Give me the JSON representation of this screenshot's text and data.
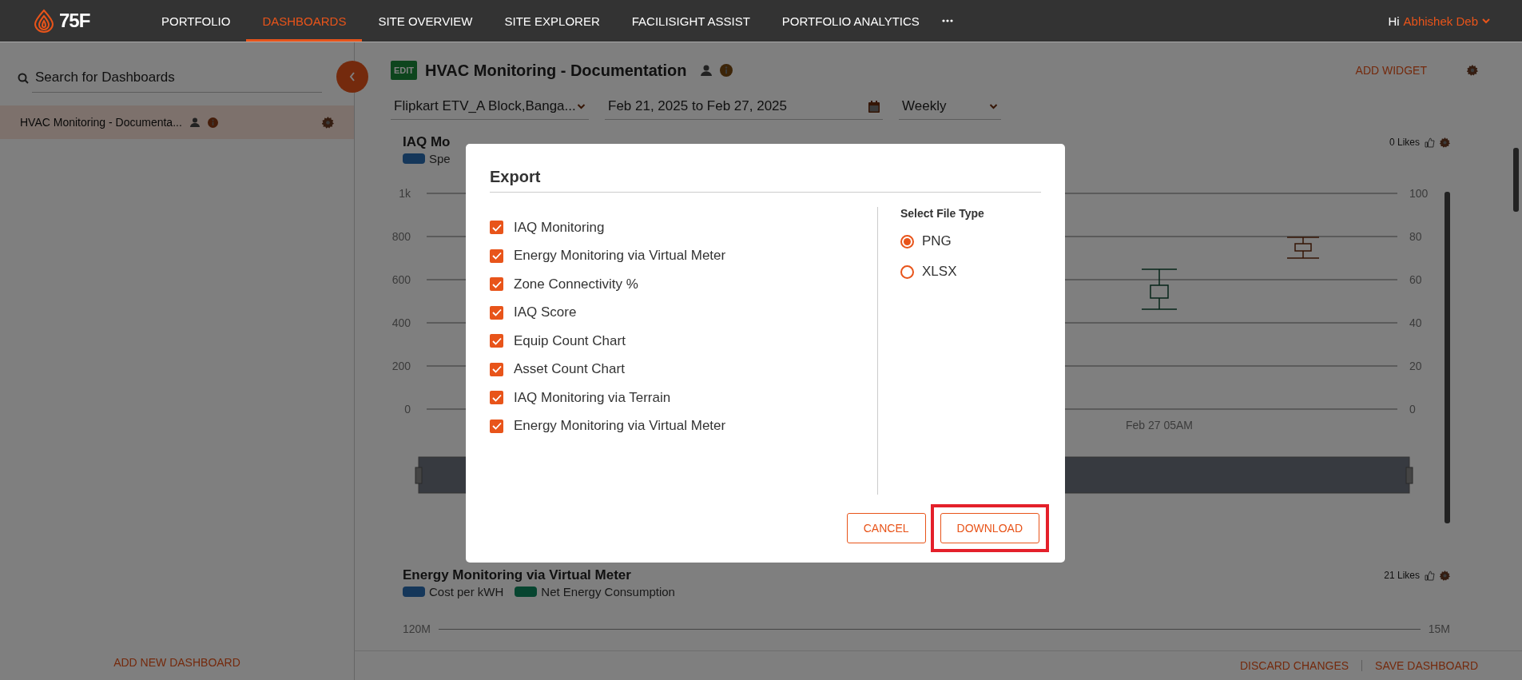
{
  "header": {
    "logo_text": "75F",
    "nav": [
      {
        "label": "PORTFOLIO",
        "selected": false
      },
      {
        "label": "DASHBOARDS",
        "selected": true
      },
      {
        "label": "SITE OVERVIEW",
        "selected": false
      },
      {
        "label": "SITE EXPLORER",
        "selected": false
      },
      {
        "label": "FACILISIGHT ASSIST",
        "selected": false
      },
      {
        "label": "PORTFOLIO ANALYTICS",
        "selected": false
      }
    ],
    "greeting": "Hi",
    "user": "Abhishek Deb"
  },
  "sidebar": {
    "search_placeholder": "Search for Dashboards",
    "items": [
      {
        "label": "HVAC Monitoring - Documenta...",
        "selected": true
      }
    ],
    "add_button": "ADD NEW DASHBOARD"
  },
  "dashboard": {
    "edit_badge": "EDIT",
    "title": "HVAC Monitoring - Documentation",
    "add_widget": "ADD WIDGET",
    "filters": {
      "site": "Flipkart ETV_A Block,Banga...",
      "date_range": "Feb 21, 2025 to Feb 27, 2025",
      "interval": "Weekly"
    },
    "widgets": [
      {
        "title": "IAQ Mo",
        "likes": "0 Likes",
        "legend": [
          {
            "label": "Spe",
            "color": "#15375a"
          }
        ],
        "left_ticks": [
          "1k",
          "800",
          "600",
          "400",
          "200",
          "0"
        ],
        "right_ticks": [
          "100",
          "80",
          "60",
          "40",
          "20",
          "0"
        ],
        "x_label": "Feb 27 05AM"
      },
      {
        "title": "Energy Monitoring via Virtual Meter",
        "likes": "21 Likes",
        "legend": [
          {
            "label": "Cost per kWH",
            "color": "#15375a"
          },
          {
            "label": "Net Energy Consumption",
            "color": "#074530"
          }
        ],
        "left_ticks": [
          "120M"
        ],
        "right_ticks": [
          "15M"
        ]
      }
    ],
    "discard": "DISCARD CHANGES",
    "save": "SAVE DASHBOARD"
  },
  "dialog": {
    "title": "Export",
    "items": [
      {
        "label": "IAQ Monitoring",
        "checked": true
      },
      {
        "label": "Energy Monitoring via Virtual Meter",
        "checked": true
      },
      {
        "label": "Zone Connectivity %",
        "checked": true
      },
      {
        "label": "IAQ Score",
        "checked": true
      },
      {
        "label": "Equip Count Chart",
        "checked": true
      },
      {
        "label": "Asset Count Chart",
        "checked": true
      },
      {
        "label": "IAQ Monitoring via Terrain",
        "checked": true
      },
      {
        "label": "Energy Monitoring via Virtual Meter",
        "checked": true
      }
    ],
    "file_type_heading": "Select File Type",
    "file_types": [
      {
        "label": "PNG",
        "selected": true
      },
      {
        "label": "XLSX",
        "selected": false
      }
    ],
    "cancel": "CANCEL",
    "download": "DOWNLOAD",
    "download_highlighted": true
  }
}
